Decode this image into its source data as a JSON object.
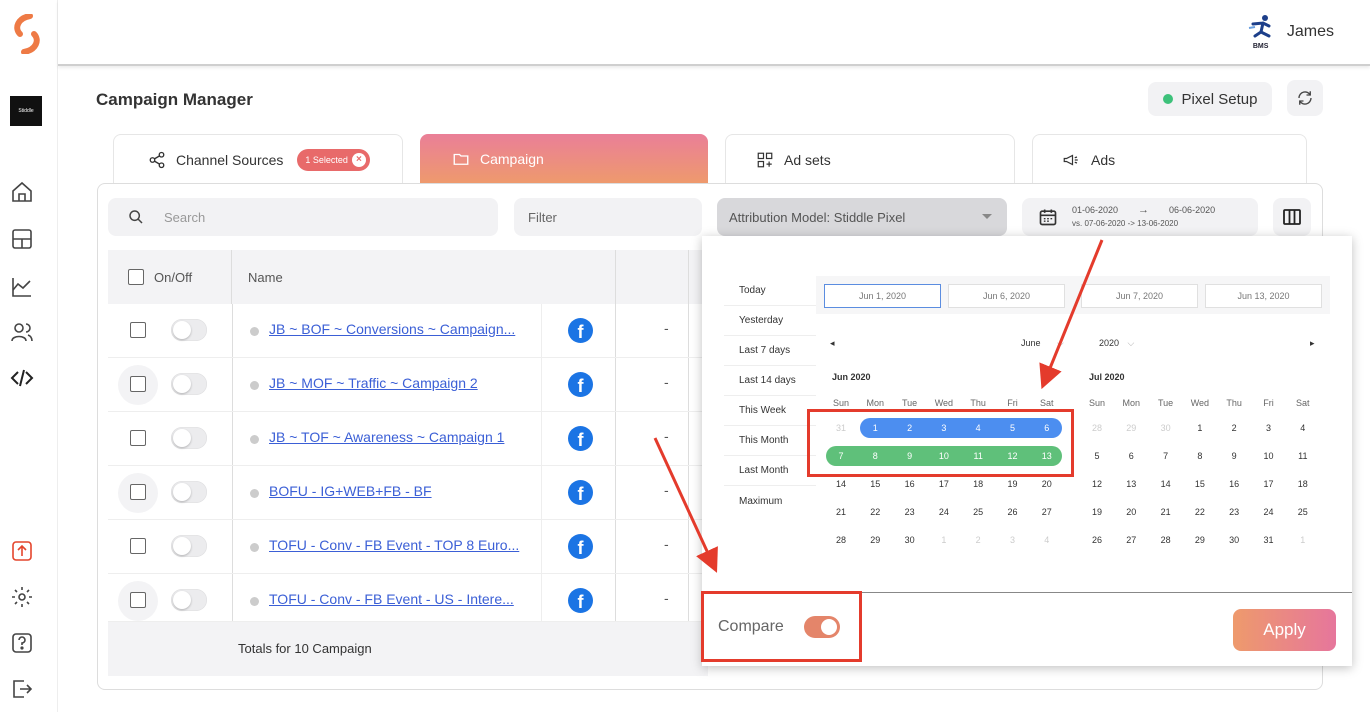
{
  "brand": {
    "workspace_label": "Stiddle"
  },
  "user": {
    "org": "BMS",
    "name": "James"
  },
  "page": {
    "title": "Campaign Manager",
    "pixel_setup_label": "Pixel Setup"
  },
  "tabs": {
    "channel": "Channel Sources",
    "channel_badge": "1 Selected",
    "campaign": "Campaign",
    "adsets": "Ad sets",
    "ads": "Ads"
  },
  "toolbar": {
    "search_placeholder": "Search",
    "filter_label": "Filter",
    "attribution": "Attribution Model: Stiddle Pixel",
    "date_from": "01-06-2020",
    "date_arrow": "→",
    "date_to": "06-06-2020",
    "date_compare": "vs. 07-06-2020 -> 13-06-2020"
  },
  "table": {
    "col_onoff": "On/Off",
    "col_name": "Name",
    "rows": [
      {
        "name": "JB ~ BOF ~ Conversions ~ Campaign...",
        "value": "-"
      },
      {
        "name": "JB ~ MOF ~ Traffic ~ Campaign 2",
        "value": "-"
      },
      {
        "name": "JB ~ TOF ~ Awareness ~ Campaign 1",
        "value": "-"
      },
      {
        "name": "BOFU - IG+WEB+FB - BF",
        "value": "-"
      },
      {
        "name": "TOFU - Conv - FB Event - TOP 8 Euro...",
        "value": "-"
      },
      {
        "name": "TOFU - Conv - FB Event - US - Intere...",
        "value": "-"
      }
    ],
    "totals": "Totals for 10 Campaign"
  },
  "picker": {
    "presets": [
      "Today",
      "Yesterday",
      "Last 7 days",
      "Last 14 days",
      "This Week",
      "This Month",
      "Last Month",
      "Maximum"
    ],
    "inputs": [
      "Jun 1, 2020",
      "Jun 6, 2020",
      "Jun 7, 2020",
      "Jun 13, 2020"
    ],
    "month_select": "June",
    "year_select": "2020",
    "left_month": "Jun 2020",
    "right_month": "Jul 2020",
    "weekdays": [
      "Sun",
      "Mon",
      "Tue",
      "Wed",
      "Thu",
      "Fri",
      "Sat"
    ],
    "compare_label": "Compare",
    "apply_label": "Apply",
    "colors": {
      "selected": "#4c8ef0",
      "compare": "#5fc07a"
    }
  }
}
